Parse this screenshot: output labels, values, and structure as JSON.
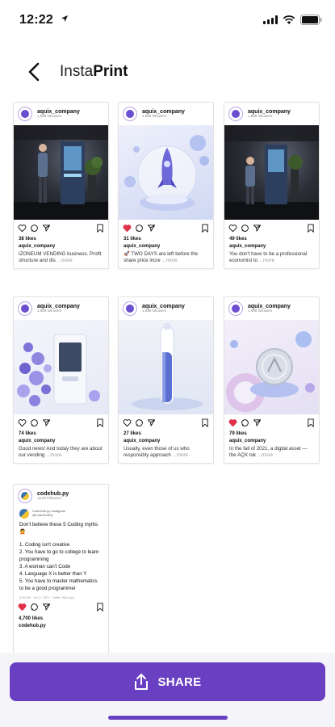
{
  "status": {
    "time": "12:22"
  },
  "header": {
    "title_part1": "Insta",
    "title_part2": "Print"
  },
  "posts": [
    {
      "account": "aquix_company",
      "followers": "1,898 followers",
      "likes": "38 likes",
      "caption_account": "aquix_company",
      "caption": "IZONEUM VENDING business. Profit structure and dis",
      "more": "...more",
      "liked": false
    },
    {
      "account": "aquix_company",
      "followers": "1,898 followers",
      "likes": "31 likes",
      "caption_account": "aquix_company",
      "caption": "🚀 TWO DAYS are left before the share price incre",
      "more": "...more",
      "liked": true
    },
    {
      "account": "aquix_company",
      "followers": "1,898 followers",
      "likes": "49 likes",
      "caption_account": "aquix_company",
      "caption": "You don't have to be a professional economist to",
      "more": "...more",
      "liked": false
    },
    {
      "account": "aquix_company",
      "followers": "1,898 followers",
      "likes": "74 likes",
      "caption_account": "aquix_company",
      "caption": "Good news! And today they are about our vending",
      "more": "...more",
      "liked": false
    },
    {
      "account": "aquix_company",
      "followers": "1,898 followers",
      "likes": "27 likes",
      "caption_account": "aquix_company",
      "caption": "Usually, even those of us who responsibly approach",
      "more": "...more",
      "liked": false
    },
    {
      "account": "aquix_company",
      "followers": "1,898 followers",
      "likes": "79 likes",
      "caption_account": "aquix_company",
      "caption": "In the fall of 2021, a digital asset — the AQX tok",
      "more": "...more",
      "liked": true
    }
  ],
  "tweet_post": {
    "account": "codehub.py",
    "followers": "19.8k followers",
    "tweet_author": "CodeHub.py Instagram",
    "tweet_handle": "@CodeHubPy",
    "tweet_lines": [
      "Don't believe these 5 Coding myths🙅",
      "",
      "1. Coding isn't creative",
      "2. You have to go to college to learn programming",
      "3. A woman can't Code",
      "4. Language X is better than Y",
      "5. You have to master mathematics to be a good programmer"
    ],
    "tweet_meta": "5:26 AM · Jun 4, 2021 · Twitter Web App",
    "likes": "4,700 likes",
    "caption_account": "codehub.py",
    "liked": true
  },
  "share": {
    "label": "SHARE"
  },
  "colors": {
    "accent": "#6a40c2",
    "like": "#e0334a"
  }
}
